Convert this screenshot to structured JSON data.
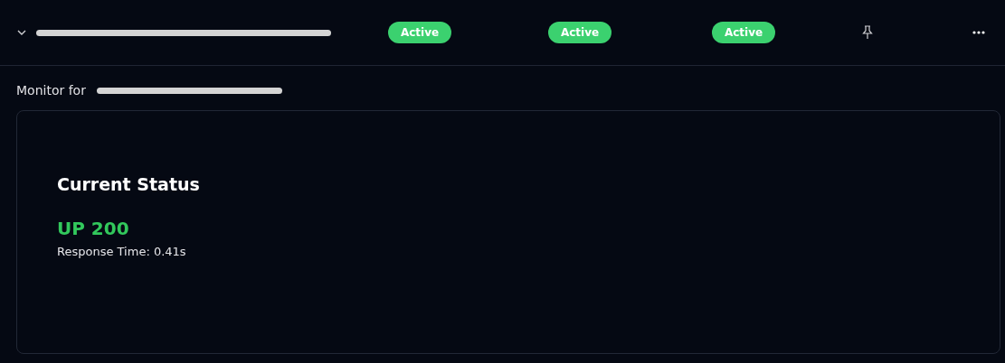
{
  "row": {
    "expanded": true,
    "statuses": [
      {
        "label": "Active",
        "color": "#3bd16f"
      },
      {
        "label": "Active",
        "color": "#3bd16f"
      },
      {
        "label": "Active",
        "color": "#3bd16f"
      }
    ],
    "pinned": false
  },
  "detail": {
    "label": "Monitor for",
    "card": {
      "title": "Current Status",
      "status": "UP 200",
      "healthy": true,
      "response": "Response Time: 0.41s"
    }
  }
}
